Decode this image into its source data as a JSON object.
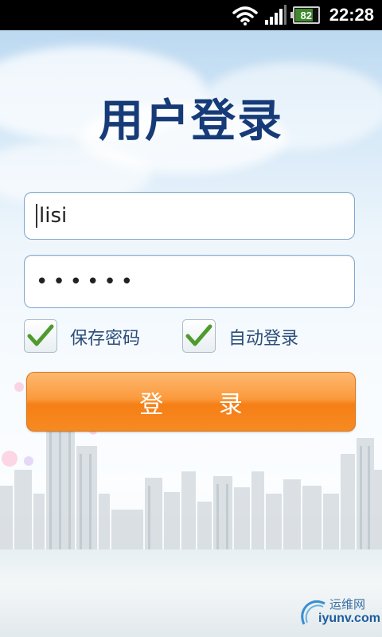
{
  "status_bar": {
    "time": "22:28",
    "battery_level": "82",
    "icons": [
      "wifi-icon",
      "signal-icon",
      "battery-icon"
    ]
  },
  "login": {
    "title": "用户登录",
    "username_value": "lisi",
    "password_value": "••••••",
    "remember_password": {
      "label": "保存密码",
      "checked": true
    },
    "auto_login": {
      "label": "自动登录",
      "checked": true
    },
    "login_button_label": "登 录"
  },
  "watermark": {
    "top": "运维网",
    "bottom": "iyunv.com"
  },
  "colors": {
    "title": "#173b78",
    "button": "#f68a22",
    "check": "#4f9a2e",
    "field_border": "#7fa8d3"
  }
}
